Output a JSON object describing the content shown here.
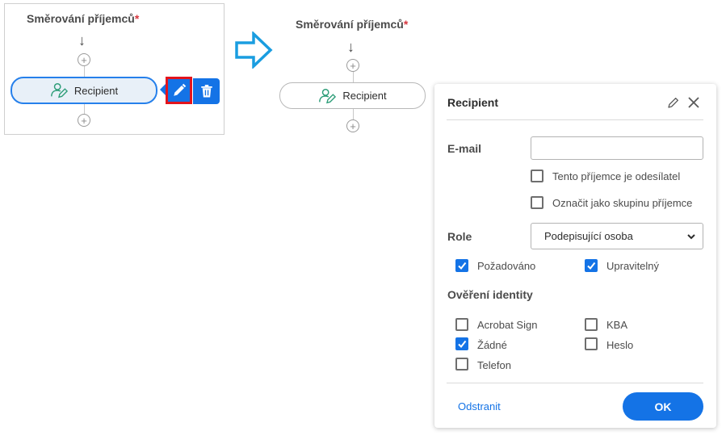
{
  "before": {
    "heading": "Směrování příjemců",
    "required_mark": "*",
    "recipient_label": "Recipient"
  },
  "after": {
    "heading": "Směrování příjemců",
    "required_mark": "*",
    "recipient_label": "Recipient"
  },
  "popover": {
    "title": "Recipient",
    "email_label": "E-mail",
    "email_value": "",
    "sender_checkbox": {
      "label": "Tento příjemce je odesílatel",
      "checked": false
    },
    "group_checkbox": {
      "label": "Označit jako skupinu příjemce",
      "checked": false
    },
    "role_label": "Role",
    "role_value": "Podepisující osoba",
    "required": {
      "label": "Požadováno",
      "checked": true
    },
    "editable": {
      "label": "Upravitelný",
      "checked": true
    },
    "identity_label": "Ověření identity",
    "identity_options": [
      {
        "label": "Acrobat Sign",
        "checked": false
      },
      {
        "label": "KBA",
        "checked": false
      },
      {
        "label": "Žádné",
        "checked": true
      },
      {
        "label": "Heslo",
        "checked": false
      },
      {
        "label": "Telefon",
        "checked": false
      }
    ],
    "remove_label": "Odstranit",
    "ok_label": "OK"
  },
  "colors": {
    "accent": "#1473e6",
    "highlight": "#e3141c",
    "required": "#d7373f",
    "icon_green": "#2d9d78"
  },
  "icons": [
    "arrow-down-icon",
    "plus-circle-icon",
    "recipient-signer-icon",
    "pencil-icon",
    "trash-icon",
    "right-arrow-icon",
    "close-icon",
    "chevron-down-icon",
    "checkmark-icon"
  ]
}
